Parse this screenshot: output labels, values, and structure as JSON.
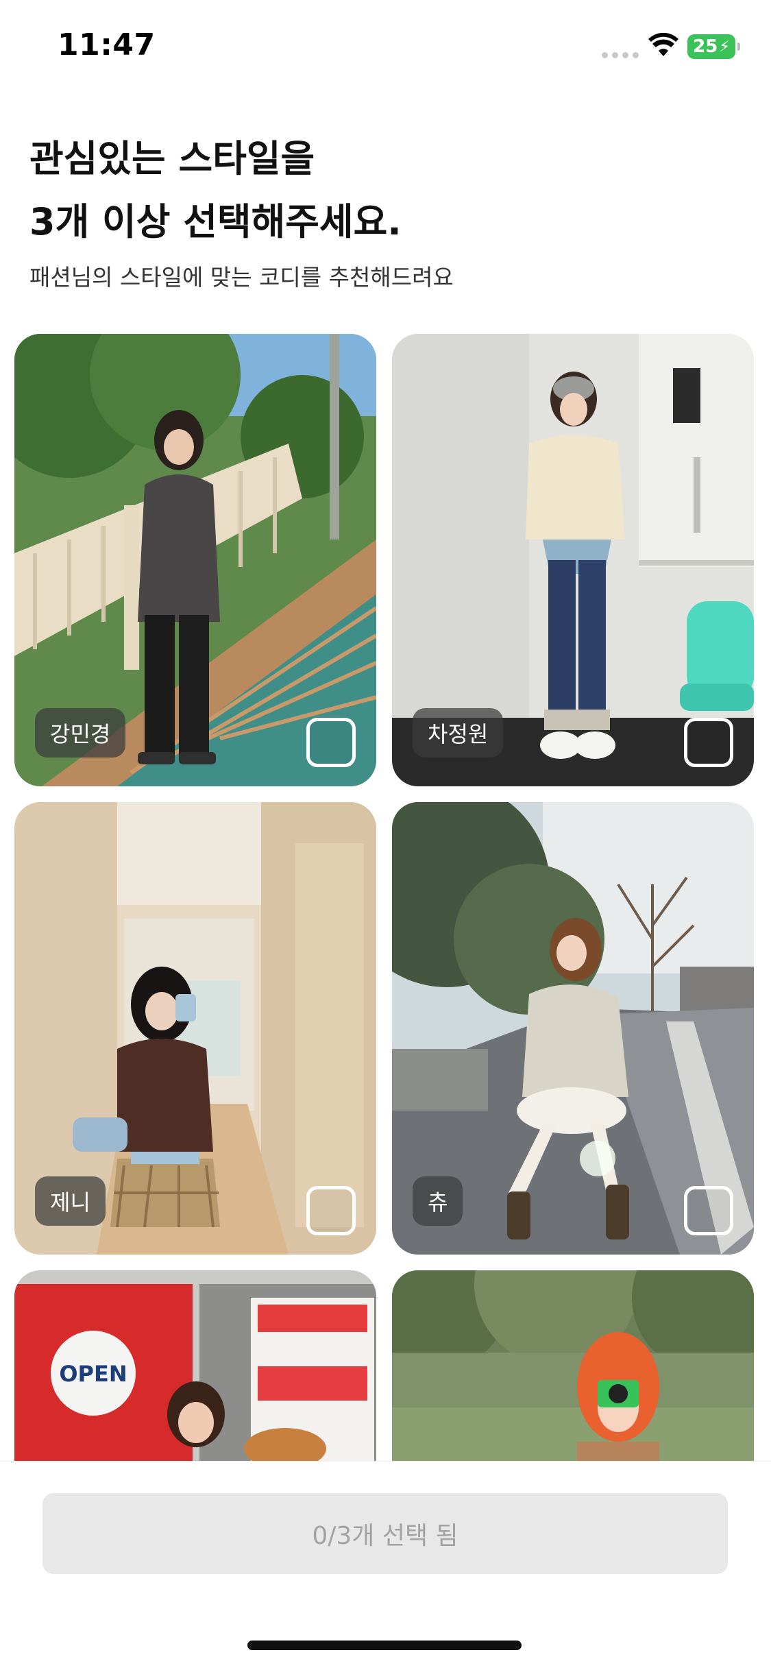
{
  "status_bar": {
    "time": "11:47",
    "battery": "25"
  },
  "header": {
    "title_line1": "관심있는 스타일을",
    "title_line2": "3개 이상 선택해주세요.",
    "subtitle": "패션님의 스타일에 맞는 코디를 추천해드려요"
  },
  "styles": [
    {
      "name": "강민경"
    },
    {
      "name": "차정원"
    },
    {
      "name": "제니"
    },
    {
      "name": "츄"
    },
    {
      "name": ""
    },
    {
      "name": ""
    }
  ],
  "bottom": {
    "button_label": "0/3개 선택 됨"
  }
}
